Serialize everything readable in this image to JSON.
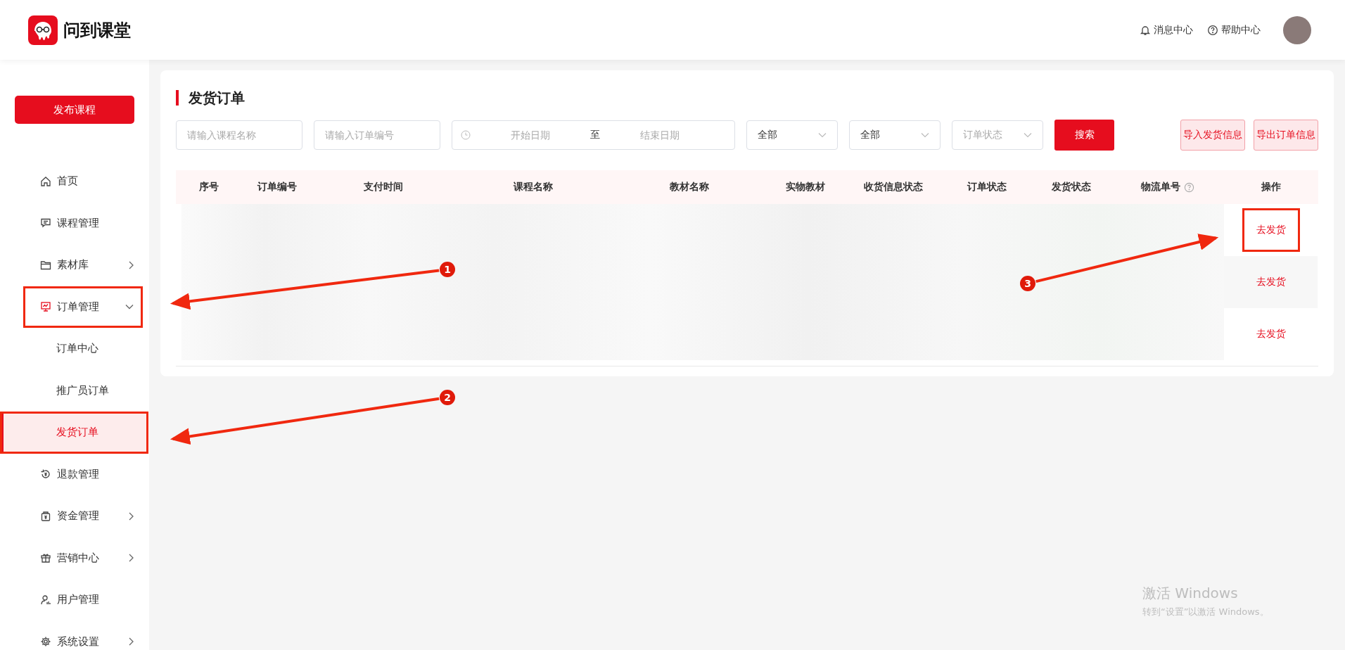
{
  "header": {
    "logo_text": "问到课堂",
    "links": [
      {
        "label": "消息中心"
      },
      {
        "label": "帮助中心"
      }
    ]
  },
  "sidebar": {
    "publish_button": "发布课程",
    "items": [
      {
        "label": "首页",
        "annotated": false
      },
      {
        "label": "课程管理",
        "annotated": false
      },
      {
        "label": "素材库",
        "expanded": false,
        "annotated": false
      },
      {
        "label": "订单管理",
        "expanded": true,
        "annotated": true,
        "children": [
          {
            "label": "订单中心",
            "selected": false,
            "annotated": false
          },
          {
            "label": "推广员订单",
            "selected": false,
            "annotated": false
          },
          {
            "label": "发货订单",
            "selected": true,
            "annotated": true
          }
        ]
      },
      {
        "label": "退款管理",
        "annotated": false
      },
      {
        "label": "资金管理",
        "expanded": false,
        "annotated": false
      },
      {
        "label": "营销中心",
        "expanded": false,
        "annotated": false
      },
      {
        "label": "用户管理",
        "annotated": false
      },
      {
        "label": "系统设置",
        "expanded": false,
        "annotated": false
      }
    ]
  },
  "page": {
    "title": "发货订单",
    "filters": {
      "course_placeholder": "请输入课程名称",
      "order_placeholder": "请输入订单编号",
      "date_start_placeholder": "开始日期",
      "date_separator": "至",
      "date_end_placeholder": "结束日期",
      "selects": [
        {
          "value": "全部"
        },
        {
          "value": "全部"
        },
        {
          "placeholder": "订单状态"
        }
      ],
      "search_button": "搜索",
      "import_button": "导入发货信息",
      "export_button": "导出订单信息"
    },
    "table": {
      "columns": [
        {
          "label": "序号",
          "help": false
        },
        {
          "label": "订单编号",
          "help": false
        },
        {
          "label": "支付时间",
          "help": false
        },
        {
          "label": "课程名称",
          "help": false
        },
        {
          "label": "教材名称",
          "help": false
        },
        {
          "label": "实物教材",
          "help": false
        },
        {
          "label": "收货信息状态",
          "help": false
        },
        {
          "label": "订单状态",
          "help": false
        },
        {
          "label": "发货状态",
          "help": false
        },
        {
          "label": "物流单号",
          "help": true
        },
        {
          "label": "操作",
          "help": false
        }
      ],
      "rows": [
        {
          "action": "去发货",
          "annotated": true
        },
        {
          "action": "去发货",
          "annotated": false
        },
        {
          "action": "去发货",
          "annotated": false
        }
      ]
    }
  },
  "annotations": [
    {
      "number": "1"
    },
    {
      "number": "2"
    },
    {
      "number": "3"
    }
  ],
  "os_notice": {
    "title": "激活 Windows",
    "text": "转到“设置”以激活 Windows。"
  }
}
